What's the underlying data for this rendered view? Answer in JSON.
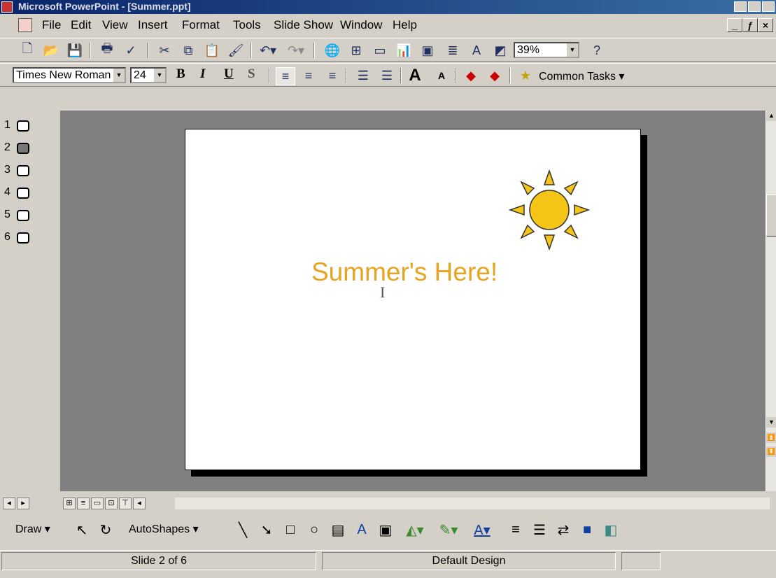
{
  "window": {
    "title": "Microsoft PowerPoint - [Summer.ppt]"
  },
  "menu": {
    "items": [
      "File",
      "Edit",
      "View",
      "Insert",
      "Format",
      "Tools",
      "Slide Show",
      "Window",
      "Help"
    ],
    "window_buttons": [
      "_",
      "ƒ",
      "×"
    ]
  },
  "standard_toolbar": {
    "zoom": "39%",
    "help": "?"
  },
  "formatting_toolbar": {
    "font": "Times New Roman",
    "size": "24",
    "bold": "B",
    "italic": "I",
    "underline": "U",
    "shadow": "S",
    "common_tasks": "Common Tasks"
  },
  "outline": {
    "slides": [
      "1",
      "2",
      "3",
      "4",
      "5",
      "6"
    ],
    "active_slide": "2"
  },
  "slide": {
    "title": "Summer's Here!",
    "title_color": "#e6a520",
    "sun_color": "#f5c518"
  },
  "drawing_toolbar": {
    "draw": "Draw",
    "autoshapes": "AutoShapes"
  },
  "status": {
    "slide": "Slide 2 of 6",
    "design": "Default Design"
  }
}
